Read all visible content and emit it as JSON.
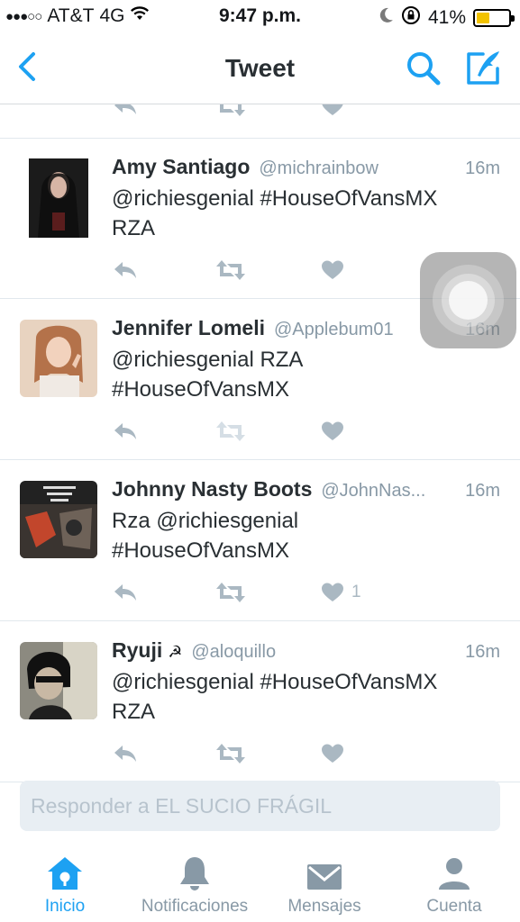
{
  "status_bar": {
    "carrier": "AT&T",
    "network": "4G",
    "time": "9:47 p.m.",
    "battery": "41%",
    "battery_level": 0.41,
    "colors": {
      "battery": "#f2c300"
    }
  },
  "nav": {
    "title": "Tweet",
    "icons": {
      "back": "chevron-left-icon",
      "search": "search-icon",
      "compose": "compose-icon"
    },
    "accent": "#1da1f2"
  },
  "tweets": [
    {
      "name": "Amy Santiago",
      "handle": "@michrainbow",
      "time": "16m",
      "text_line1": "@richiesgenial #HouseOfVansMX",
      "text_line2": "RZA",
      "likes": ""
    },
    {
      "name": "Jennifer Lomeli",
      "handle": "@Applebum01",
      "time": "16m",
      "text_line1": "@richiesgenial RZA",
      "text_line2": "#HouseOfVansMX",
      "likes": ""
    },
    {
      "name": "Johnny Nasty Boots",
      "handle": "@JohnNas...",
      "time": "16m",
      "text_line1": "Rza @richiesgenial",
      "text_line2": "#HouseOfVansMX",
      "likes": "1"
    },
    {
      "name": "Ryuji",
      "name_emoji": "☭",
      "handle": "@aloquillo",
      "time": "16m",
      "text_line1": "@richiesgenial #HouseOfVansMX",
      "text_line2": "RZA",
      "likes": ""
    }
  ],
  "reply": {
    "placeholder": "Responder a EL SUCIO FRÁGIL"
  },
  "tabbar": {
    "tabs": [
      {
        "label": "Inicio",
        "icon": "home-icon",
        "active": true
      },
      {
        "label": "Notificaciones",
        "icon": "bell-icon",
        "active": false
      },
      {
        "label": "Mensajes",
        "icon": "envelope-icon",
        "active": false
      },
      {
        "label": "Cuenta",
        "icon": "person-icon",
        "active": false
      }
    ]
  }
}
